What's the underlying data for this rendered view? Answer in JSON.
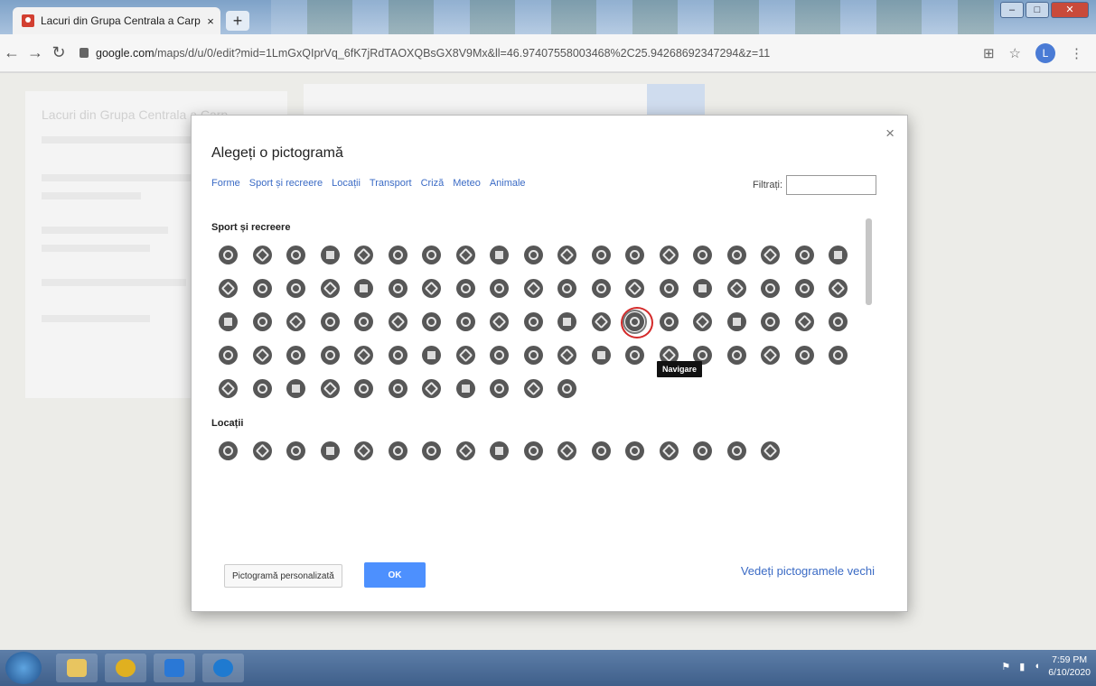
{
  "browser": {
    "tab_title": "Lacuri din Grupa Centrala a Carpa",
    "tab_close": "×",
    "new_tab": "+",
    "url_host": "google.com",
    "url_path": "/maps/d/u/0/edit?mid=1LmGxQIprVq_6fK7jRdTAOXQBsGX8V9Mx&ll=46.97407558003468%2C25.94268692347294&z=11",
    "profile_initial": "L",
    "window_buttons": [
      "–",
      "□",
      "✕"
    ]
  },
  "map_panel": {
    "title": "Lacuri din Grupa Centrala a Carp"
  },
  "dialog": {
    "title": "Alegeți o pictogramă",
    "close": "×",
    "categories": [
      "Forme",
      "Sport și recreere",
      "Locații",
      "Transport",
      "Criză",
      "Meteo",
      "Animale"
    ],
    "filter_label": "Filtrați:",
    "filter_value": "",
    "section_sport": "Sport și recreere",
    "section_locations": "Locații",
    "tooltip": "Navigare",
    "custom_button": "Pictogramă personalizată",
    "ok_button": "OK",
    "old_icons_link": "Vedeți pictogramele vechi",
    "sport_icon_count": 87,
    "location_icon_count": 17,
    "selected_icon": "Navigare"
  },
  "taskbar": {
    "time": "7:59 PM",
    "date": "6/10/2020"
  }
}
